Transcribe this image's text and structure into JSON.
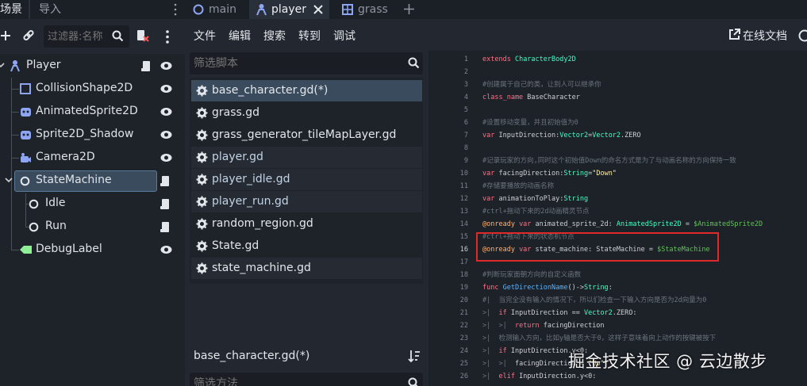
{
  "dock_tabs": [
    "场景",
    "导入"
  ],
  "scene_filter_placeholder": "过滤器:名称",
  "scene_tree": [
    {
      "label": "Player",
      "icon": "character-body-icon"
    },
    {
      "label": "CollisionShape2D",
      "icon": "collision-shape-icon"
    },
    {
      "label": "AnimatedSprite2D",
      "icon": "animated-sprite-icon"
    },
    {
      "label": "Sprite2D_Shadow",
      "icon": "sprite-icon"
    },
    {
      "label": "Camera2D",
      "icon": "camera-icon"
    },
    {
      "label": "StateMachine",
      "icon": "node-icon"
    },
    {
      "label": "Idle",
      "icon": "node-icon"
    },
    {
      "label": "Run",
      "icon": "node-icon"
    },
    {
      "label": "DebugLabel",
      "icon": "label-icon"
    }
  ],
  "editor_tabs": [
    "main",
    "player",
    "grass"
  ],
  "menu": [
    "文件",
    "编辑",
    "搜索",
    "转到",
    "调试"
  ],
  "online_docs": "在线文档",
  "script_filter_placeholder": "筛选脚本",
  "scripts": [
    "base_character.gd(*)",
    "grass.gd",
    "grass_generator_tileMapLayer.gd",
    "player.gd",
    "player_idle.gd",
    "player_run.gd",
    "random_region.gd",
    "State.gd",
    "state_machine.gd"
  ],
  "current_script": "base_character.gd(*)",
  "method_filter_placeholder": "筛选方法",
  "code_lines": [
    {
      "n": "1",
      "tokens": [
        [
          "kw",
          "extends "
        ],
        [
          "ty",
          "CharacterBody2D"
        ]
      ]
    },
    {
      "n": "2",
      "tokens": []
    },
    {
      "n": "3",
      "tokens": [
        [
          "cm",
          "#创建属于自己的类，让别人可以继承你"
        ]
      ]
    },
    {
      "n": "4",
      "tokens": [
        [
          "kw",
          "class_name "
        ],
        [
          "id",
          "BaseCharacter"
        ]
      ]
    },
    {
      "n": "5",
      "tokens": []
    },
    {
      "n": "6",
      "tokens": [
        [
          "cm",
          "#设置移动变量，并且初始值为0"
        ]
      ]
    },
    {
      "n": "7",
      "tokens": [
        [
          "kw",
          "var "
        ],
        [
          "id",
          "InputDirection"
        ],
        [
          "id",
          ":"
        ],
        [
          "ty",
          "Vector2"
        ],
        [
          "id",
          "="
        ],
        [
          "ty",
          "Vector2"
        ],
        [
          "id",
          ".ZERO"
        ]
      ]
    },
    {
      "n": "8",
      "tokens": []
    },
    {
      "n": "9",
      "tokens": [
        [
          "cm",
          "#记录玩家的方向,同时这个初始值Down的命名方式是为了与动画名称的方向保持一致"
        ]
      ]
    },
    {
      "n": "10",
      "tokens": [
        [
          "kw",
          "var "
        ],
        [
          "id",
          "facingDirection"
        ],
        [
          "id",
          ":"
        ],
        [
          "ty",
          "String"
        ],
        [
          "id",
          "="
        ],
        [
          "st",
          "\"Down\""
        ]
      ]
    },
    {
      "n": "11",
      "tokens": [
        [
          "cm",
          "#存储要播放的动画名称"
        ]
      ]
    },
    {
      "n": "12",
      "tokens": [
        [
          "kw",
          "var "
        ],
        [
          "id",
          "animationToPlay"
        ],
        [
          "id",
          ":"
        ],
        [
          "ty",
          "String"
        ]
      ]
    },
    {
      "n": "13",
      "tokens": [
        [
          "cm",
          "#ctrl+拖动下来的2d动画精灵节点"
        ]
      ]
    },
    {
      "n": "14",
      "tokens": [
        [
          "an",
          "@onready "
        ],
        [
          "kw",
          "var "
        ],
        [
          "id",
          "animated_sprite_2d: "
        ],
        [
          "ty",
          "AnimatedSprite2D"
        ],
        [
          "id",
          " = "
        ],
        [
          "ng",
          "$AnimatedSprite2D"
        ]
      ]
    },
    {
      "n": "15",
      "tokens": [
        [
          "cm",
          "#ctrl+拖动下来的状态机节点"
        ]
      ]
    },
    {
      "n": "16",
      "tokens": [
        [
          "an",
          "@onready "
        ],
        [
          "kw",
          "var "
        ],
        [
          "id",
          "state_machine: StateMachine = "
        ],
        [
          "ng",
          "$StateMachine"
        ]
      ]
    },
    {
      "n": "17",
      "tokens": []
    },
    {
      "n": "18",
      "tokens": [
        [
          "cm",
          "#判断玩家面朝方向的自定义函数"
        ]
      ]
    },
    {
      "n": "19",
      "tokens": [
        [
          "kw",
          "func "
        ],
        [
          "fn",
          "GetDirectionName"
        ],
        [
          "id",
          "()->"
        ],
        [
          "ty",
          "String"
        ],
        [
          "id",
          ":"
        ]
      ]
    },
    {
      "n": "20",
      "tokens": [
        [
          "cm",
          "#|  当完全没有输入的情况下，所以们检查一下输入方向是否为2d向量为0"
        ]
      ]
    },
    {
      "n": "21",
      "tokens": [
        [
          "cm",
          ">|  "
        ],
        [
          "kw",
          "if "
        ],
        [
          "id",
          "InputDirection == "
        ],
        [
          "ty",
          "Vector2"
        ],
        [
          "id",
          ".ZERO:"
        ]
      ]
    },
    {
      "n": "22",
      "tokens": [
        [
          "cm",
          ">|  >|  "
        ],
        [
          "kw",
          "return "
        ],
        [
          "id",
          "facingDirection"
        ]
      ]
    },
    {
      "n": "23",
      "tokens": [
        [
          "cm",
          ">|  检测输入方向，比如y轴是否大于0，这样子意味着向上动作的按键被按下"
        ]
      ]
    },
    {
      "n": "24",
      "tokens": [
        [
          "cm",
          ">|  "
        ],
        [
          "kw",
          "if "
        ],
        [
          "id",
          "InputDirection.y<0:"
        ]
      ]
    },
    {
      "n": "25",
      "tokens": [
        [
          "cm",
          ">|  >|  "
        ],
        [
          "id",
          "facingDirection = "
        ],
        [
          "st",
          "\"Up\""
        ]
      ]
    },
    {
      "n": "26",
      "tokens": [
        [
          "cm",
          ">|  "
        ],
        [
          "kw",
          "elif "
        ],
        [
          "id",
          "InputDirection.y<0:"
        ]
      ]
    }
  ],
  "watermark": "掘金技术社区 @ 云边散步",
  "colors": {
    "accent": "#3b4b5e",
    "highlight_box": "#e02a2a"
  }
}
